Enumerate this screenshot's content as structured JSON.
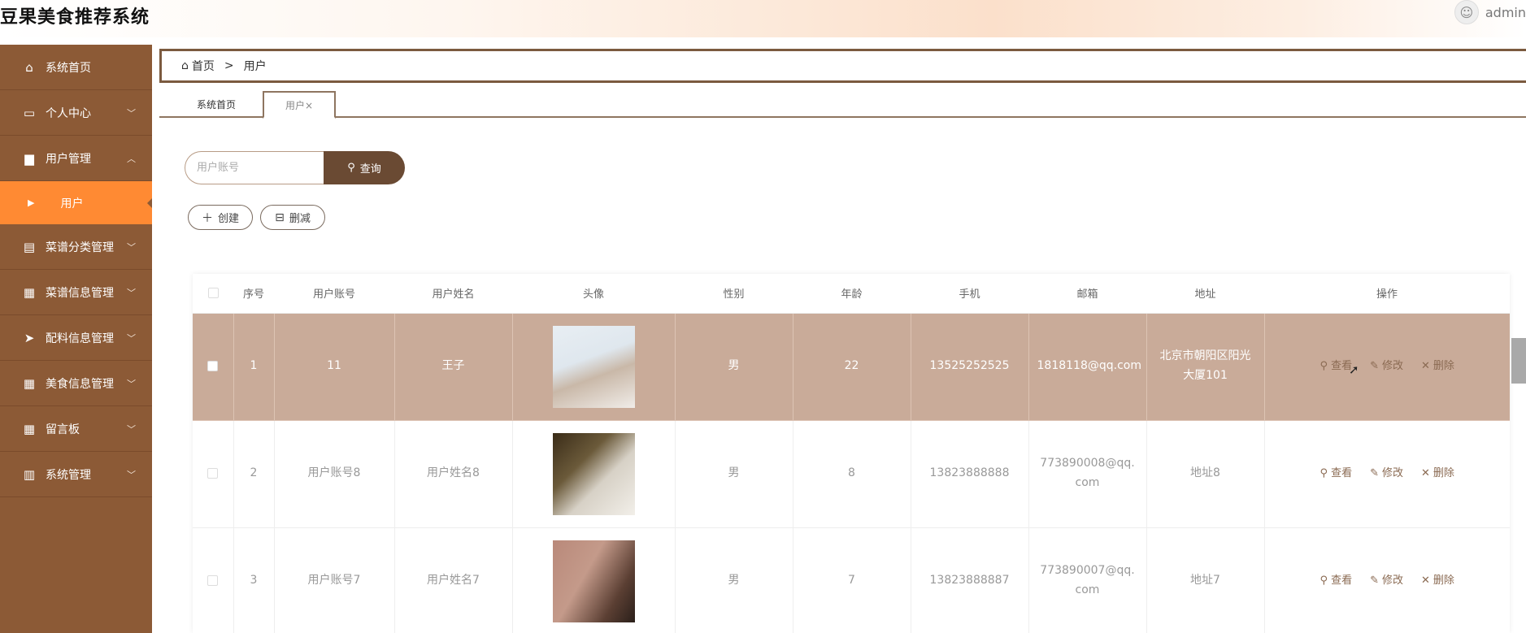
{
  "app": {
    "title": "豆果美食推荐系统"
  },
  "user": {
    "name": "admin"
  },
  "sidebar": {
    "items": [
      {
        "label": "系统首页",
        "icon": "home-icon"
      },
      {
        "label": "个人中心",
        "icon": "card-icon"
      },
      {
        "label": "用户管理",
        "icon": "briefcase-icon"
      },
      {
        "label": "菜谱分类管理",
        "icon": "clipboard-icon"
      },
      {
        "label": "菜谱信息管理",
        "icon": "grid-icon"
      },
      {
        "label": "配料信息管理",
        "icon": "send-icon"
      },
      {
        "label": "美食信息管理",
        "icon": "grid-icon"
      },
      {
        "label": "留言板",
        "icon": "grid-icon"
      },
      {
        "label": "系统管理",
        "icon": "bar-chart-icon"
      }
    ],
    "active_sub": "用户"
  },
  "breadcrumb": {
    "home": "首页",
    "separator": ">",
    "current": "用户"
  },
  "tabs": {
    "home": "系统首页",
    "active": "用户×"
  },
  "search": {
    "placeholder": "用户账号",
    "button": "查询"
  },
  "actions": {
    "create": "创建",
    "delete": "删减"
  },
  "table": {
    "headers": [
      "序号",
      "用户账号",
      "用户姓名",
      "头像",
      "性别",
      "年龄",
      "手机",
      "邮箱",
      "地址",
      "操作"
    ],
    "op_labels": {
      "view": "查看",
      "edit": "修改",
      "delete": "删除"
    },
    "rows": [
      {
        "no": "1",
        "account": "11",
        "name": "王子",
        "gender": "男",
        "age": "22",
        "phone": "13525252525",
        "email": "1818118@qq.com",
        "address": "北京市朝阳区阳光大厦101"
      },
      {
        "no": "2",
        "account": "用户账号8",
        "name": "用户姓名8",
        "gender": "男",
        "age": "8",
        "phone": "13823888888",
        "email": "773890008@qq.com",
        "address": "地址8"
      },
      {
        "no": "3",
        "account": "用户账号7",
        "name": "用户姓名7",
        "gender": "男",
        "age": "7",
        "phone": "13823888887",
        "email": "773890007@qq.com",
        "address": "地址7"
      }
    ]
  },
  "colors": {
    "sidebar": "#8c5a36",
    "active_menu": "#ff8a33",
    "selected_row": "#c9ab99",
    "accent_dark": "#6a4a33"
  }
}
